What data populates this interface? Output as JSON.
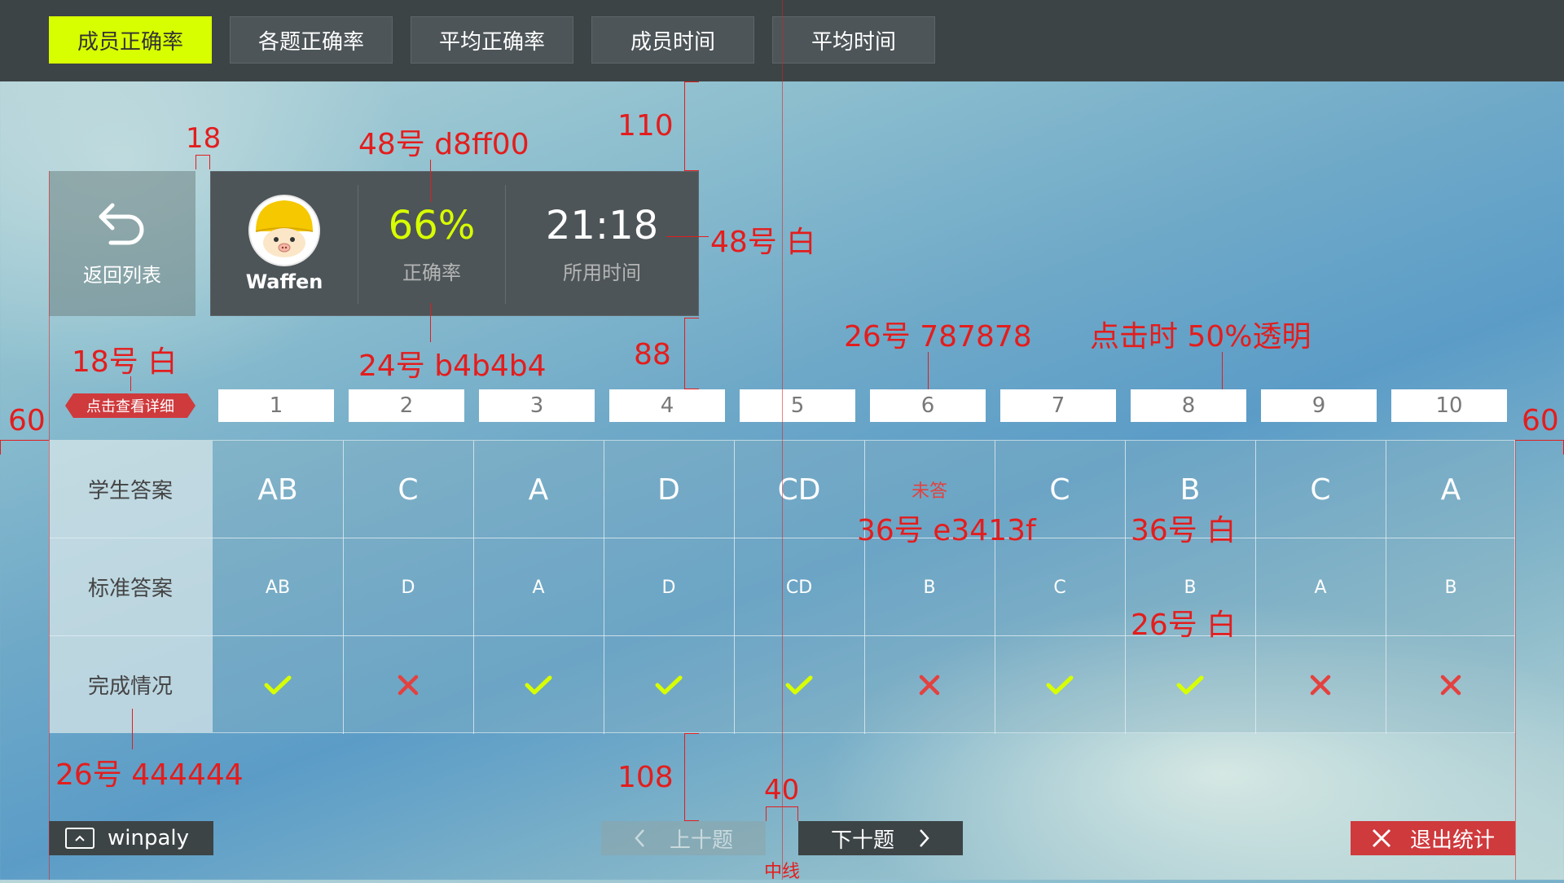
{
  "tabs": [
    {
      "label": "成员正确率",
      "active": true
    },
    {
      "label": "各题正确率",
      "active": false
    },
    {
      "label": "平均正确率",
      "active": false
    },
    {
      "label": "成员时间",
      "active": false
    },
    {
      "label": "平均时间",
      "active": false
    }
  ],
  "back": {
    "label": "返回列表"
  },
  "member": {
    "name": "Waffen"
  },
  "stats": {
    "accuracy_value": "66%",
    "accuracy_label": "正确率",
    "time_value": "21:18",
    "time_label": "所用时间"
  },
  "detail_tag": "点击查看详细",
  "questions": [
    "1",
    "2",
    "3",
    "4",
    "5",
    "6",
    "7",
    "8",
    "9",
    "10"
  ],
  "table": {
    "row_headers": [
      "学生答案",
      "标准答案",
      "完成情况"
    ],
    "student_answers": [
      "AB",
      "C",
      "A",
      "D",
      "CD",
      "未答",
      "C",
      "B",
      "C",
      "A"
    ],
    "standard_answers": [
      "AB",
      "D",
      "A",
      "D",
      "CD",
      "B",
      "C",
      "B",
      "A",
      "B"
    ],
    "results": [
      "correct",
      "wrong",
      "correct",
      "correct",
      "correct",
      "wrong",
      "correct",
      "correct",
      "wrong",
      "wrong"
    ]
  },
  "footer": {
    "app_label": "winpaly",
    "prev_label": "上十题",
    "next_label": "下十题",
    "exit_label": "退出统计"
  },
  "colors": {
    "accent": "#d8ff00",
    "error": "#e3413f",
    "header_text": "#444444",
    "number_text": "#787878",
    "sub_text": "#b4b4b4",
    "dark": "#3d4446",
    "annotation": "#e31d1d"
  },
  "annotations": {
    "a_18": "18",
    "a_110": "110",
    "a_48_accent": "48号  d8ff00",
    "a_48_white": "48号  白",
    "a_18_white": "18号  白",
    "a_24_gray": "24号  b4b4b4",
    "a_88": "88",
    "a_26_number": "26号  787878",
    "a_click": "点击时  50%透明",
    "a_60_left": "60",
    "a_60_right": "60",
    "a_36_red": "36号  e3413f",
    "a_36_white": "36号  白",
    "a_26_white": "26号  白",
    "a_26_gray": "26号  444444",
    "a_108": "108",
    "a_40": "40",
    "a_center": "中线"
  }
}
